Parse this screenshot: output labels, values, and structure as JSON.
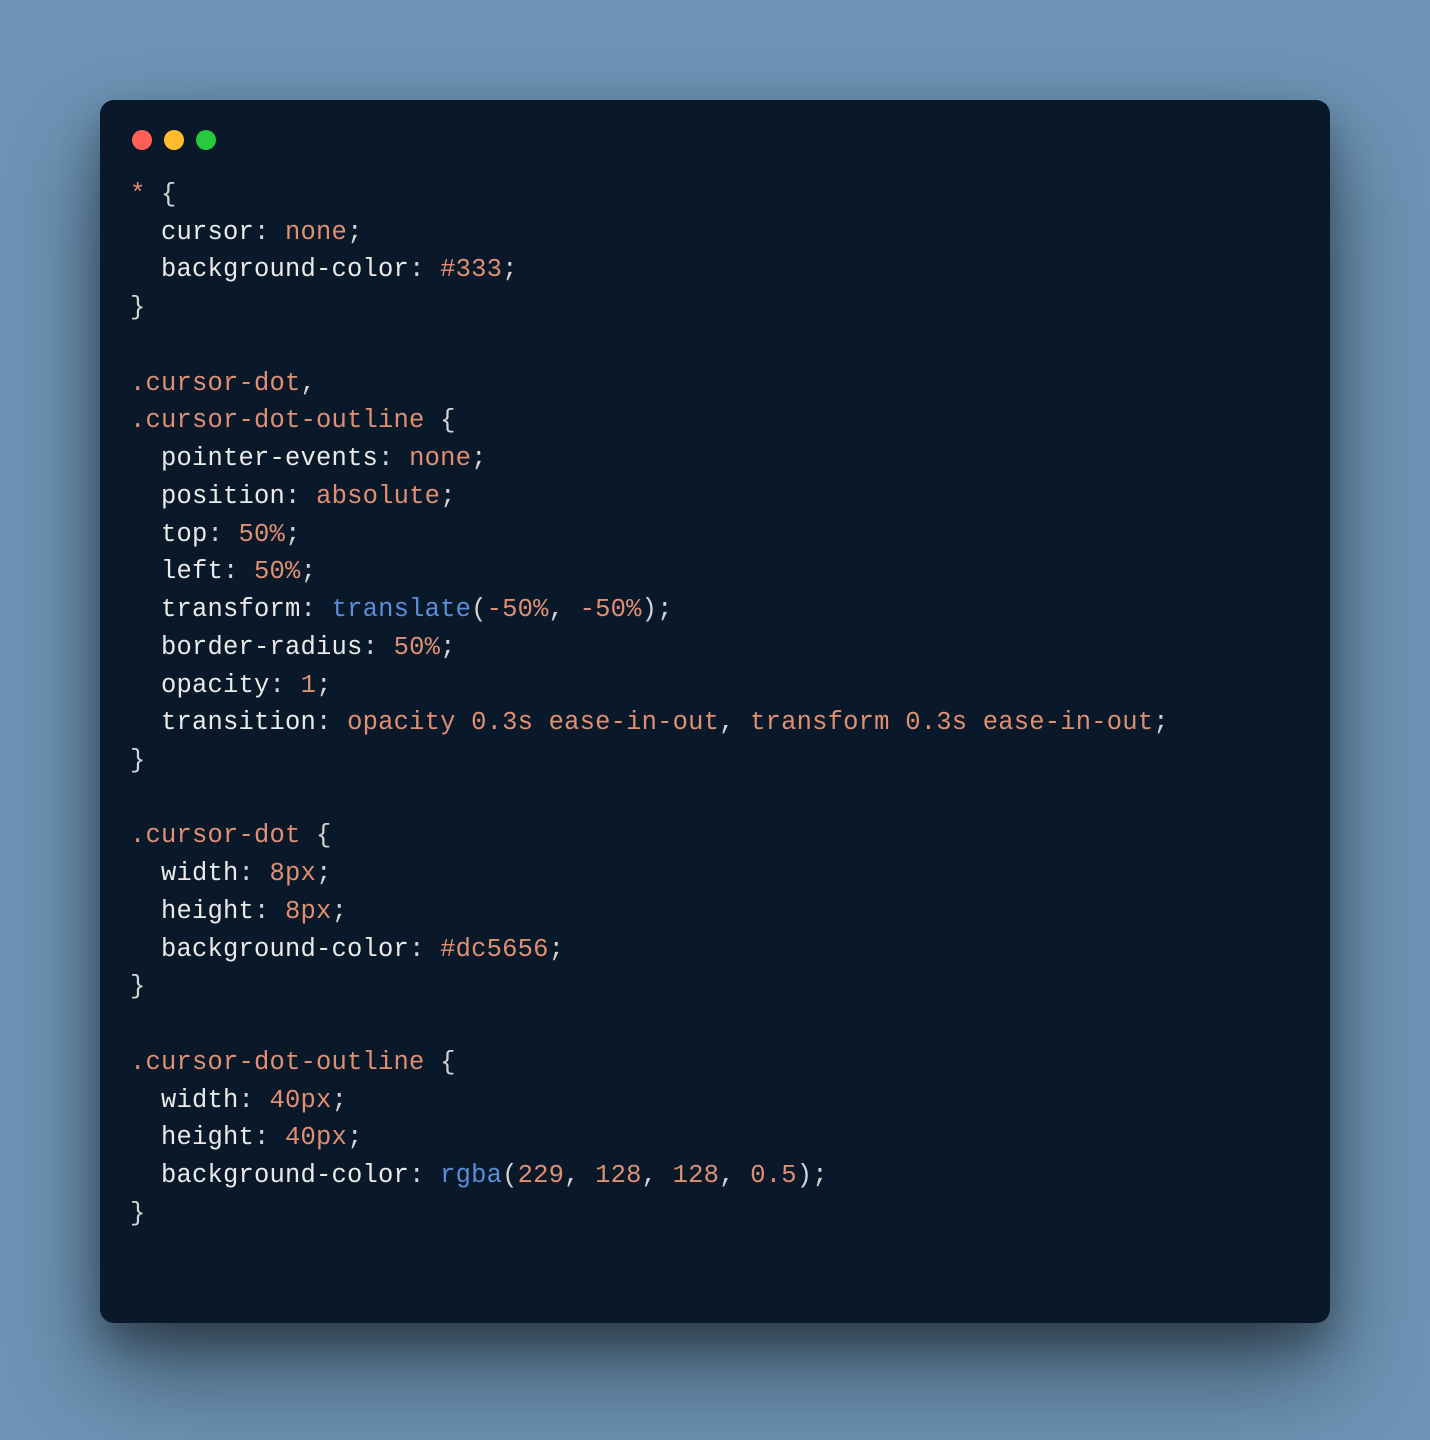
{
  "colors": {
    "background": "#6d94b5",
    "editor_bg": "#0a1929",
    "traffic_red": "#ff5f56",
    "traffic_yellow": "#ffbd2e",
    "traffic_green": "#27c93f"
  },
  "code": {
    "b1": {
      "sel": "*",
      "open": " {"
    },
    "b1l1": {
      "i": "  ",
      "p": "cursor",
      "c": ": ",
      "v": "none",
      "e": ";"
    },
    "b1l2": {
      "i": "  ",
      "p": "background-color",
      "c": ": ",
      "v": "#333",
      "e": ";"
    },
    "b1c": {
      "c": "}"
    },
    "b2": {
      "s1": ".cursor-dot",
      "comma": ",",
      "s2": ".cursor-dot-outline",
      "open": " {"
    },
    "b2l1": {
      "i": "  ",
      "p": "pointer-events",
      "c": ": ",
      "v": "none",
      "e": ";"
    },
    "b2l2": {
      "i": "  ",
      "p": "position",
      "c": ": ",
      "v": "absolute",
      "e": ";"
    },
    "b2l3": {
      "i": "  ",
      "p": "top",
      "c": ": ",
      "v": "50%",
      "e": ";"
    },
    "b2l4": {
      "i": "  ",
      "p": "left",
      "c": ": ",
      "v": "50%",
      "e": ";"
    },
    "b2l5": {
      "i": "  ",
      "p": "transform",
      "c": ": ",
      "fn": "translate",
      "op": "(",
      "a1": "-50%",
      "comma": ", ",
      "a2": "-50%",
      "cp": ")",
      "e": ";"
    },
    "b2l6": {
      "i": "  ",
      "p": "border-radius",
      "c": ": ",
      "v": "50%",
      "e": ";"
    },
    "b2l7": {
      "i": "  ",
      "p": "opacity",
      "c": ": ",
      "v": "1",
      "e": ";"
    },
    "b2l8": {
      "i": "  ",
      "p": "transition",
      "c": ": ",
      "v1": "opacity ",
      "v2": "0.3s",
      "v3": " ease-in-out",
      "comma": ", ",
      "v4": "transform ",
      "v5": "0.3s",
      "v6": " ease-in-out",
      "e": ";"
    },
    "b2c": {
      "c": "}"
    },
    "b3": {
      "sel": ".cursor-dot",
      "open": " {"
    },
    "b3l1": {
      "i": "  ",
      "p": "width",
      "c": ": ",
      "v": "8px",
      "e": ";"
    },
    "b3l2": {
      "i": "  ",
      "p": "height",
      "c": ": ",
      "v": "8px",
      "e": ";"
    },
    "b3l3": {
      "i": "  ",
      "p": "background-color",
      "c": ": ",
      "v": "#dc5656",
      "e": ";"
    },
    "b3c": {
      "c": "}"
    },
    "b4": {
      "sel": ".cursor-dot-outline",
      "open": " {"
    },
    "b4l1": {
      "i": "  ",
      "p": "width",
      "c": ": ",
      "v": "40px",
      "e": ";"
    },
    "b4l2": {
      "i": "  ",
      "p": "height",
      "c": ": ",
      "v": "40px",
      "e": ";"
    },
    "b4l3": {
      "i": "  ",
      "p": "background-color",
      "c": ": ",
      "fn": "rgba",
      "op": "(",
      "a1": "229",
      "c1": ", ",
      "a2": "128",
      "c2": ", ",
      "a3": "128",
      "c3": ", ",
      "a4": "0.5",
      "cp": ")",
      "e": ";"
    },
    "b4c": {
      "c": "}"
    }
  }
}
